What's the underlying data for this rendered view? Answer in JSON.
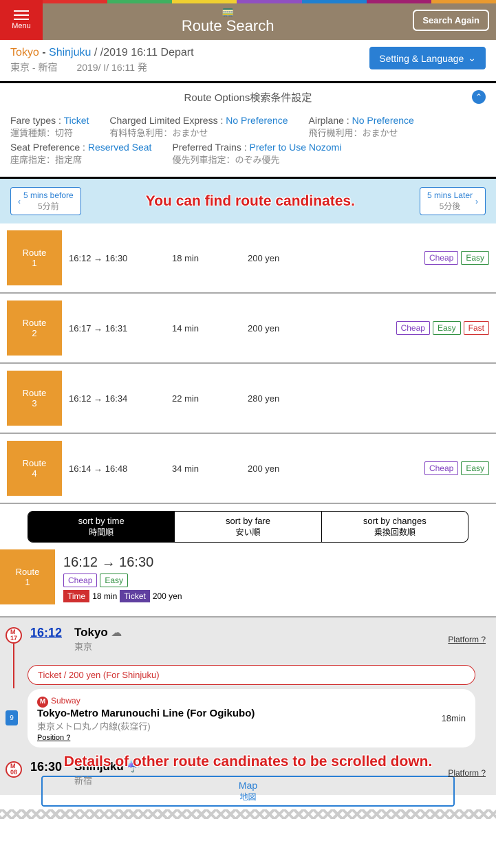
{
  "header": {
    "menu": "Menu",
    "title": "Route Search",
    "search_again": "Search Again"
  },
  "color_bar": [
    "#e0302c",
    "#40b060",
    "#f0d030",
    "#9050c0",
    "#2080d0",
    "#a02070",
    "#e99a2f"
  ],
  "route": {
    "from_en": "Tokyo",
    "to_en": "Shinjuku",
    "date": "   /   /2019 16:11 Depart",
    "from_jp": "東京 - 新宿",
    "date_jp": "2019/  I/    16:11 発"
  },
  "settings_btn": "Setting & Language",
  "options_title": "Route Options検索条件設定",
  "options": [
    [
      {
        "l": "Fare types :",
        "v": "Ticket",
        "jl": "運賃種類：",
        "jv": "切符"
      },
      {
        "l": "Charged Limited Express :",
        "v": "No Preference",
        "jl": "有料特急利用：",
        "jv": "おまかせ"
      },
      {
        "l": "Airplane :",
        "v": "No Preference",
        "jl": "飛行機利用：",
        "jv": "おまかせ"
      }
    ],
    [
      {
        "l": "Seat Preference :",
        "v": "Reserved Seat",
        "jl": "座席指定：",
        "jv": "指定席"
      },
      {
        "l": "Preferred Trains :",
        "v": "Prefer to Use Nozomi",
        "jl": "優先列車指定：",
        "jv": "のぞみ優先"
      }
    ]
  ],
  "time_nav": {
    "before_en": "5 mins before",
    "before_jp": "5分前",
    "later_en": "5 mins Later",
    "later_jp": "5分後"
  },
  "overlay1": "You can find route candinates.",
  "routes": [
    {
      "n": "1",
      "t": "16:12 → 16:30",
      "d": "18 min",
      "p": "200 yen",
      "b": [
        "cheap",
        "easy"
      ]
    },
    {
      "n": "2",
      "t": "16:17 → 16:31",
      "d": "14 min",
      "p": "200 yen",
      "b": [
        "cheap",
        "easy",
        "fast"
      ]
    },
    {
      "n": "3",
      "t": "16:12 → 16:34",
      "d": "22 min",
      "p": "280 yen",
      "b": []
    },
    {
      "n": "4",
      "t": "16:14 → 16:48",
      "d": "34 min",
      "p": "200 yen",
      "b": [
        "cheap",
        "easy"
      ]
    }
  ],
  "badges": {
    "cheap": "Cheap",
    "easy": "Easy",
    "fast": "Fast"
  },
  "route_label": "Route",
  "sort": [
    {
      "en": "sort by time",
      "jp": "時間順",
      "active": true
    },
    {
      "en": "sort by fare",
      "jp": "安い順",
      "active": false
    },
    {
      "en": "sort by changes",
      "jp": "乗換回数順",
      "active": false
    }
  ],
  "detail": {
    "n": "1",
    "time_range": "16:12 → 16:30",
    "b": [
      "cheap",
      "easy"
    ],
    "time_label": "Time",
    "dur": "18 min",
    "ticket_label": "Ticket",
    "price": "200 yen"
  },
  "timeline": {
    "dep": {
      "m": "M\n17",
      "t": "16:12",
      "en": "Tokyo",
      "jp": "東京",
      "plat": "Platform ?",
      "weather": "☁"
    },
    "ticket": "Ticket / 200 yen (For Shinjuku)",
    "line": {
      "sub": "Subway",
      "name": "Tokyo-Metro Marunouchi Line (For Ogikubo)",
      "jp": "東京メトロ丸ノ内線(荻窪行)",
      "pos": "Position ?",
      "dur": "18min",
      "durnum": "9"
    },
    "arr": {
      "m": "M\n08",
      "t": "16:30",
      "en": "Shinjuku",
      "jp": "新宿",
      "plat": "Platform ?",
      "weather": "☔"
    }
  },
  "overlay2": "Details of other route candinates to be scrolled down.",
  "map": {
    "en": "Map",
    "jp": "地図"
  }
}
